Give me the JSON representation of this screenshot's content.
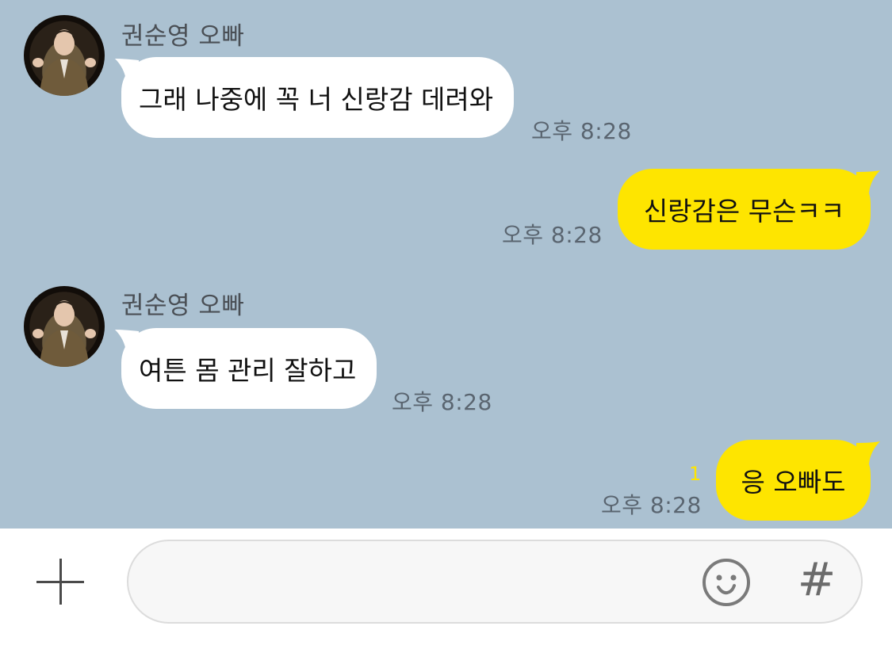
{
  "messages": [
    {
      "sender": "권순영 오빠",
      "text": "그래 나중에 꼭 너 신랑감 데려와",
      "time": "오후 8:28",
      "direction": "incoming"
    },
    {
      "text": "신랑감은 무슨ㅋㅋ",
      "time": "오후 8:28",
      "direction": "outgoing"
    },
    {
      "sender": "권순영 오빠",
      "text": "여튼 몸 관리 잘하고",
      "time": "오후 8:28",
      "direction": "incoming"
    },
    {
      "text": "응 오빠도",
      "time": "오후 8:28",
      "direction": "outgoing",
      "unread_count": "1"
    }
  ],
  "input": {
    "value": "",
    "placeholder": "",
    "emoji_icon": "emoji-icon",
    "hash_label": "#",
    "plus_icon": "plus-icon"
  },
  "colors": {
    "chat_background": "#abc1d1",
    "outgoing_bubble": "#fee500",
    "incoming_bubble": "#ffffff",
    "unread": "#fee500"
  }
}
